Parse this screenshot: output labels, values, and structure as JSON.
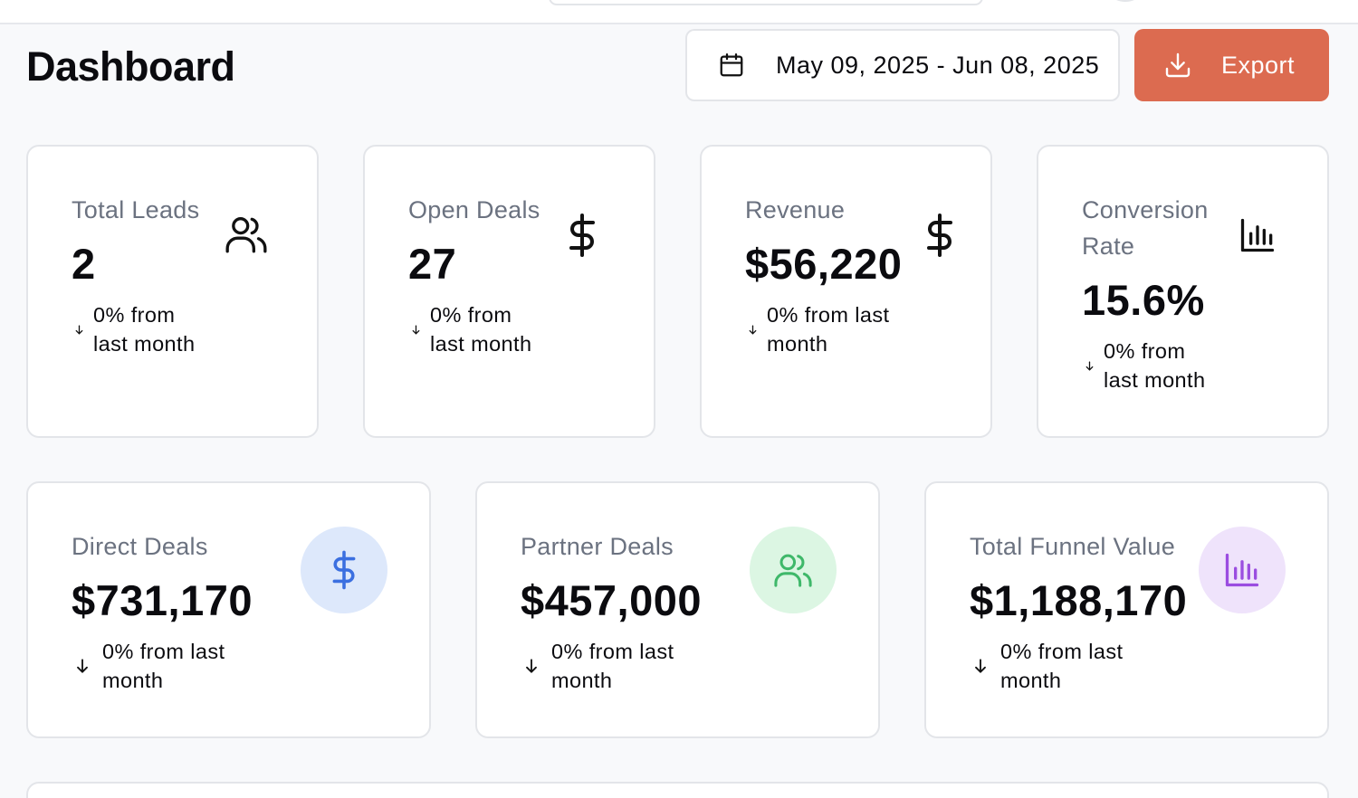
{
  "page": {
    "title": "Dashboard"
  },
  "date_range": {
    "text": "May 09, 2025 - Jun 08, 2025"
  },
  "export": {
    "label": "Export"
  },
  "colors": {
    "accent": "#dc6b50",
    "direct_icon_bg": "#dde8fb",
    "direct_icon": "#3b6fe0",
    "partner_icon_bg": "#dcf6e3",
    "partner_icon": "#3fb86a",
    "funnel_icon_bg": "#efe3fb",
    "funnel_icon": "#9b4de0"
  },
  "stats": [
    {
      "label": "Total Leads",
      "value": "2",
      "change_line1": "0% from",
      "change_line2": "last month",
      "icon": "users-icon"
    },
    {
      "label": "Open Deals",
      "value": "27",
      "change_line1": "0% from",
      "change_line2": "last month",
      "icon": "dollar-icon"
    },
    {
      "label": "Revenue",
      "value": "$56,220",
      "change_line1": "0% from last",
      "change_line2": "month",
      "icon": "dollar-icon"
    },
    {
      "label_line1": "Conversion",
      "label_line2": "Rate",
      "value": "15.6%",
      "change_line1": "0% from",
      "change_line2": "last month",
      "icon": "bar-chart-icon"
    }
  ],
  "deals": [
    {
      "label": "Direct Deals",
      "value": "$731,170",
      "change_line1": "0% from last",
      "change_line2": "month",
      "icon": "dollar-icon"
    },
    {
      "label": "Partner Deals",
      "value": "$457,000",
      "change_line1": "0% from last",
      "change_line2": "month",
      "icon": "users-icon"
    },
    {
      "label": "Total Funnel Value",
      "value": "$1,188,170",
      "change_line1": "0% from last",
      "change_line2": "month",
      "icon": "bar-chart-icon"
    }
  ]
}
